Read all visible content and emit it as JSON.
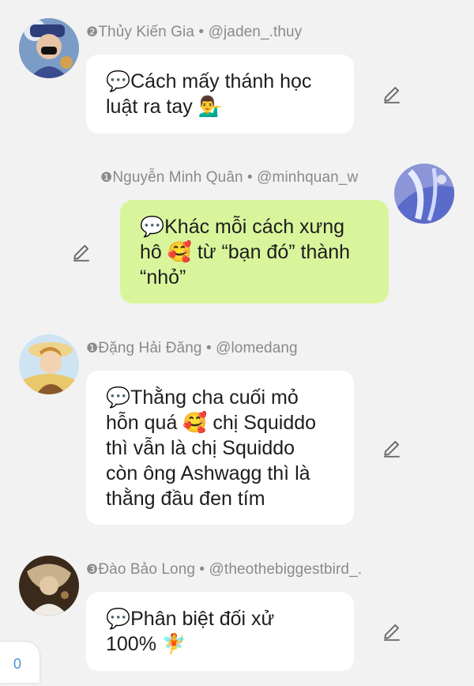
{
  "comments": [
    {
      "rank": "❷",
      "name": "Thủy Kiến Gia",
      "sep": " • ",
      "handle": "@jaden_.thuy",
      "icon": "speech-balloon-icon",
      "lines": [
        "💬Cách mấy thánh học",
        "luật ra tay 💁‍♂️"
      ]
    },
    {
      "rank": "❶",
      "name": "Nguyễn Minh Quân",
      "sep": " • ",
      "handle": "@minhquan_w",
      "lines": [
        "💬Khác mỗi cách xưng",
        "hô 🥰 từ “bạn đó” thành",
        "“nhỏ”"
      ]
    },
    {
      "rank": "❶",
      "name": "Đặng Hải Đăng",
      "sep": " • ",
      "handle": "@lomedang",
      "lines": [
        "💬Thằng cha cuối mỏ",
        "hỗn quá 🥰  chị Squiddo",
        "thì vẫn là chị Squiddo",
        "còn ông Ashwagg thì là",
        "thằng đầu đen tím"
      ]
    },
    {
      "rank": "❸",
      "name": "Đào Bảo Long",
      "sep": " • ",
      "handle": "@theothebiggestbird_.",
      "lines": [
        "💬Phân biệt đối xử",
        "100% 🧚"
      ]
    }
  ],
  "counter": "0",
  "colors": {
    "mine_bubble": "#d9f59c",
    "other_bubble": "#ffffff",
    "meta": "#8a8a8a",
    "counter": "#4f8fd4"
  }
}
